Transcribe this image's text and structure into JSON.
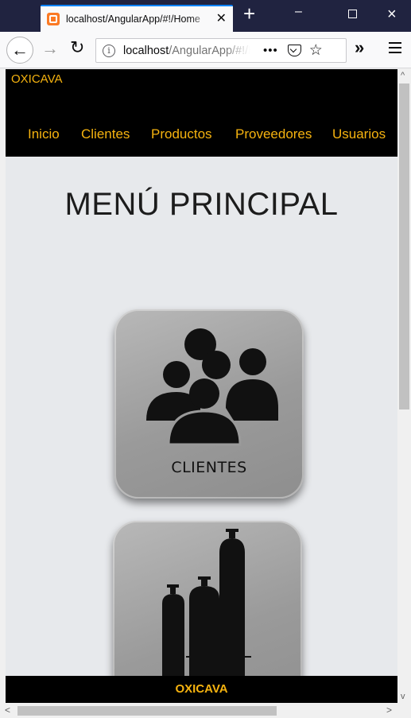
{
  "browser": {
    "tab_title": "localhost/AngularApp/#!/Home",
    "tab_close": "✕",
    "new_tab": "+",
    "url_host": "localhost",
    "url_path": "/AngularApp/#!/Home",
    "page_actions": "•••",
    "star": "☆",
    "overflow": "»",
    "info": "i"
  },
  "header": {
    "brand": "OXICAVA",
    "nav": [
      {
        "label": "Inicio"
      },
      {
        "label": "Clientes"
      },
      {
        "label": "Productos"
      },
      {
        "label": "Proveedores"
      },
      {
        "label": "Usuarios"
      }
    ]
  },
  "main": {
    "title": "MENÚ PRINCIPAL",
    "cards": [
      {
        "label": "CLIENTES",
        "icon": "people-group-icon"
      },
      {
        "label": "",
        "icon": "gas-cylinders-icon"
      }
    ]
  },
  "footer": {
    "text": "OXICAVA"
  },
  "colors": {
    "accent": "#f6b30f",
    "header_bg": "#000000",
    "page_bg": "#e7e9ec",
    "card_bg": "#9a9a9a",
    "titlebar_bg": "#202340"
  }
}
